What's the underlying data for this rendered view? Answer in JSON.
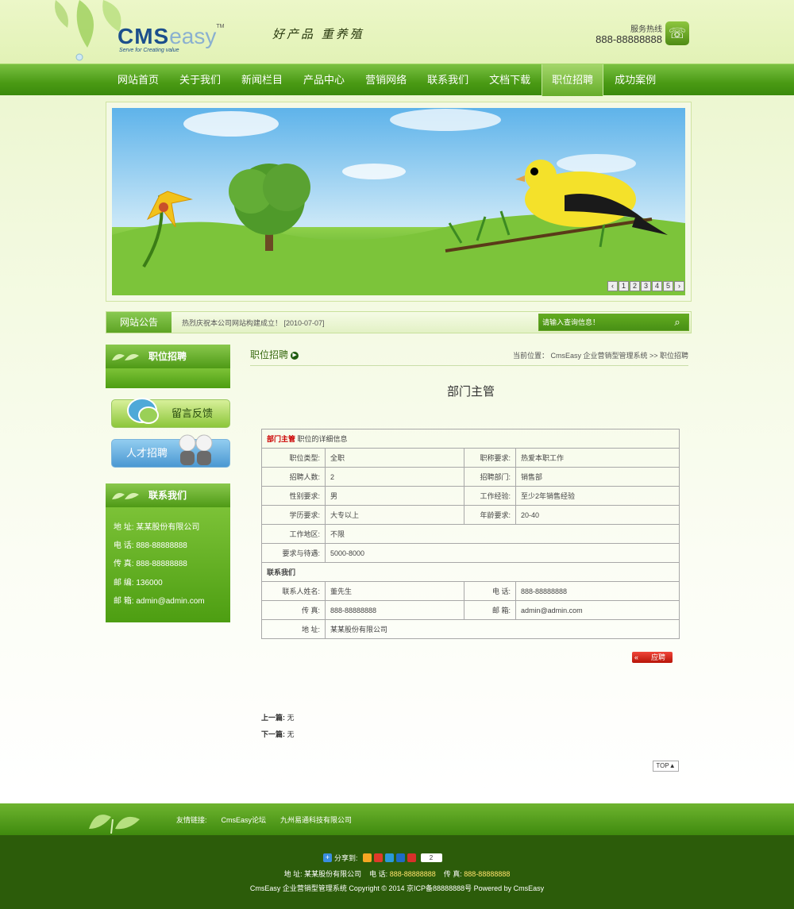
{
  "header": {
    "logo_main": "CMS",
    "logo_sub": "easy",
    "logo_tm": "TM",
    "logo_tagline": "Serve for Creating value",
    "slogan": "好产品 重养殖",
    "hotline_label": "服务热线",
    "hotline_number": "888-88888888"
  },
  "nav": {
    "items": [
      "网站首页",
      "关于我们",
      "新闻栏目",
      "产品中心",
      "营销网络",
      "联系我们",
      "文档下载",
      "职位招聘",
      "成功案例"
    ],
    "active_index": 7
  },
  "banner": {
    "pages": [
      "‹",
      "1",
      "2",
      "3",
      "4",
      "5",
      "›"
    ]
  },
  "notice": {
    "label": "网站公告",
    "text": "热烈庆祝本公司网站构建成立！ [2010-07-07]",
    "search_placeholder": "请输入查询信息！"
  },
  "sidebar": {
    "category_title": "职位招聘",
    "feedback_label": "留言反馈",
    "talent_label": "人才招聘",
    "contact_title": "联系我们",
    "contact_lines": [
      "地 址: 某某股份有限公司",
      "电 话: 888-88888888",
      "传 真: 888-88888888",
      "邮 编: 136000",
      "邮 箱: admin@admin.com"
    ]
  },
  "main": {
    "section_title": "职位招聘",
    "breadcrumb": "当前位置： CmsEasy 企业营销型管理系统  >> 职位招聘",
    "job_title": "部门主管",
    "detail_heading_name": "部门主管",
    "detail_heading_suffix": " 职位的详细信息",
    "rows": [
      {
        "l1": "职位类型:",
        "v1": "全职",
        "l2": "职称要求:",
        "v2": "热爱本职工作"
      },
      {
        "l1": "招聘人数:",
        "v1": "2",
        "l2": "招聘部门:",
        "v2": "销售部"
      },
      {
        "l1": "性别要求:",
        "v1": "男",
        "l2": "工作经验:",
        "v2": "至少2年销售经验"
      },
      {
        "l1": "学历要求:",
        "v1": "大专以上",
        "l2": "年龄要求:",
        "v2": "20-40"
      }
    ],
    "location_label": "工作地区:",
    "location_value": "不限",
    "salary_label": "要求与待遇:",
    "salary_value": "5000-8000",
    "contact_heading": "联系我们",
    "contact_rows": [
      {
        "l1": "联系人姓名:",
        "v1": "董先生",
        "l2": "电 话:",
        "v2": "888-88888888"
      },
      {
        "l1": "传 真:",
        "v1": "888-88888888",
        "l2": "邮 箱:",
        "v2": "admin@admin.com"
      }
    ],
    "address_label": "地 址:",
    "address_value": "某某股份有限公司",
    "apply_label": "应聘",
    "prev_label": "上一篇:",
    "prev_value": "无",
    "next_label": "下一篇:",
    "next_value": "无",
    "top_label": "TOP▲"
  },
  "footer": {
    "links_label": "友情链接:",
    "links": [
      "CmsEasy论坛",
      "九州易通科技有限公司"
    ],
    "share_label": "分享到:",
    "share_count": "2",
    "info_address": "地 址: 某某股份有限公司",
    "info_phone_label": "电 话:",
    "info_phone": "888-88888888",
    "info_fax_label": "传 真:",
    "info_fax": "888-88888888",
    "copyright": "CmsEasy 企业营销型管理系统 Copyright © 2014 京ICP备88888888号 Powered by CmsEasy"
  },
  "colors": {
    "nav_green": "#4a9a14",
    "footer_dark": "#2c5c0a",
    "accent_red": "#cc0000"
  }
}
